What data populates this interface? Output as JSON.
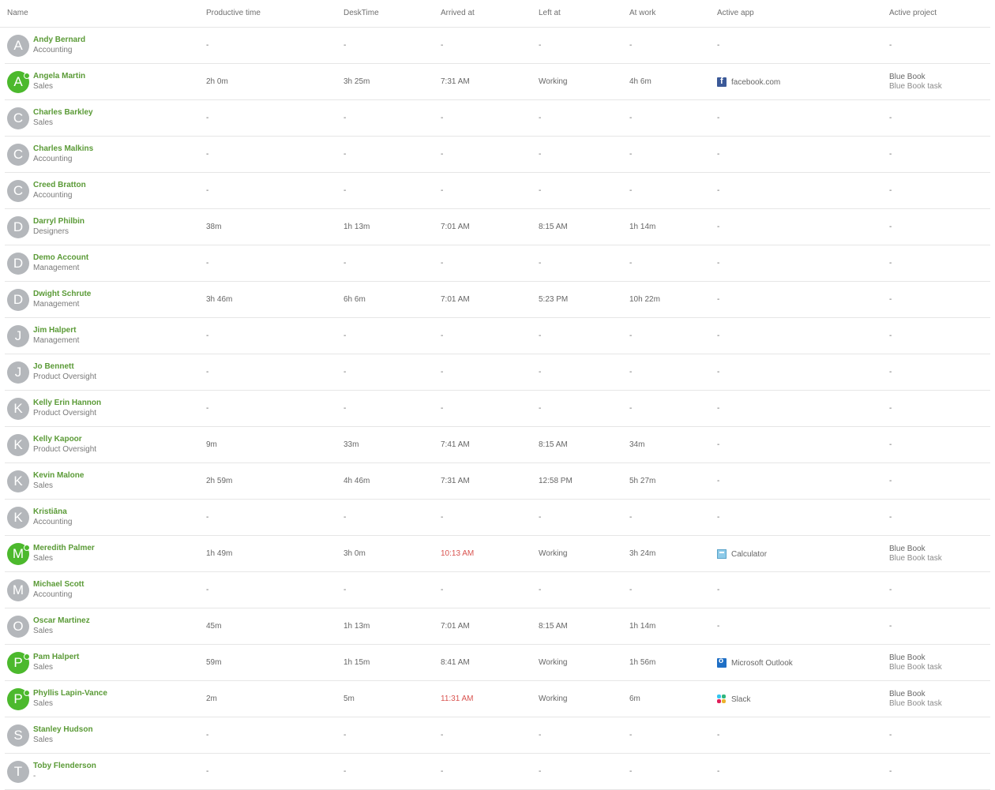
{
  "columns": {
    "name": "Name",
    "productive": "Productive time",
    "desktime": "DeskTime",
    "arrived": "Arrived at",
    "left": "Left at",
    "atwork": "At work",
    "app": "Active app",
    "project": "Active project"
  },
  "colors": {
    "name_link": "#5a9a36",
    "online": "#4cb92d",
    "offline_avatar": "#b4b7bb",
    "late": "#d9534f"
  },
  "rows": [
    {
      "initial": "A",
      "name": "Andy Bernard",
      "team": "Accounting",
      "online": false,
      "productive": "-",
      "desktime": "-",
      "arrived": "-",
      "arrived_late": false,
      "left": "-",
      "atwork": "-",
      "app": "-",
      "app_icon": "",
      "project": "-",
      "task": ""
    },
    {
      "initial": "A",
      "name": "Angela Martin",
      "team": "Sales",
      "online": true,
      "productive": "2h 0m",
      "desktime": "3h 25m",
      "arrived": "7:31 AM",
      "arrived_late": false,
      "left": "Working",
      "atwork": "4h 6m",
      "app": "facebook.com",
      "app_icon": "facebook-icon",
      "project": "Blue Book",
      "task": "Blue Book task"
    },
    {
      "initial": "C",
      "name": "Charles Barkley",
      "team": "Sales",
      "online": false,
      "productive": "-",
      "desktime": "-",
      "arrived": "-",
      "arrived_late": false,
      "left": "-",
      "atwork": "-",
      "app": "-",
      "app_icon": "",
      "project": "-",
      "task": ""
    },
    {
      "initial": "C",
      "name": "Charles Malkins",
      "team": "Accounting",
      "online": false,
      "productive": "-",
      "desktime": "-",
      "arrived": "-",
      "arrived_late": false,
      "left": "-",
      "atwork": "-",
      "app": "-",
      "app_icon": "",
      "project": "-",
      "task": ""
    },
    {
      "initial": "C",
      "name": "Creed Bratton",
      "team": "Accounting",
      "online": false,
      "productive": "-",
      "desktime": "-",
      "arrived": "-",
      "arrived_late": false,
      "left": "-",
      "atwork": "-",
      "app": "-",
      "app_icon": "",
      "project": "-",
      "task": ""
    },
    {
      "initial": "D",
      "name": "Darryl Philbin",
      "team": "Designers",
      "online": false,
      "productive": "38m",
      "desktime": "1h 13m",
      "arrived": "7:01 AM",
      "arrived_late": false,
      "left": "8:15 AM",
      "atwork": "1h 14m",
      "app": "-",
      "app_icon": "",
      "project": "-",
      "task": ""
    },
    {
      "initial": "D",
      "name": "Demo Account",
      "team": "Management",
      "online": false,
      "productive": "-",
      "desktime": "-",
      "arrived": "-",
      "arrived_late": false,
      "left": "-",
      "atwork": "-",
      "app": "-",
      "app_icon": "",
      "project": "-",
      "task": ""
    },
    {
      "initial": "D",
      "name": "Dwight Schrute",
      "team": "Management",
      "online": false,
      "productive": "3h 46m",
      "desktime": "6h 6m",
      "arrived": "7:01 AM",
      "arrived_late": false,
      "left": "5:23 PM",
      "atwork": "10h 22m",
      "app": "-",
      "app_icon": "",
      "project": "-",
      "task": ""
    },
    {
      "initial": "J",
      "name": "Jim Halpert",
      "team": "Management",
      "online": false,
      "productive": "-",
      "desktime": "-",
      "arrived": "-",
      "arrived_late": false,
      "left": "-",
      "atwork": "-",
      "app": "-",
      "app_icon": "",
      "project": "-",
      "task": ""
    },
    {
      "initial": "J",
      "name": "Jo Bennett",
      "team": "Product Oversight",
      "online": false,
      "productive": "-",
      "desktime": "-",
      "arrived": "-",
      "arrived_late": false,
      "left": "-",
      "atwork": "-",
      "app": "-",
      "app_icon": "",
      "project": "-",
      "task": ""
    },
    {
      "initial": "K",
      "name": "Kelly Erin Hannon",
      "team": "Product Oversight",
      "online": false,
      "productive": "-",
      "desktime": "-",
      "arrived": "-",
      "arrived_late": false,
      "left": "-",
      "atwork": "-",
      "app": "-",
      "app_icon": "",
      "project": "-",
      "task": ""
    },
    {
      "initial": "K",
      "name": "Kelly Kapoor",
      "team": "Product Oversight",
      "online": false,
      "productive": "9m",
      "desktime": "33m",
      "arrived": "7:41 AM",
      "arrived_late": false,
      "left": "8:15 AM",
      "atwork": "34m",
      "app": "-",
      "app_icon": "",
      "project": "-",
      "task": ""
    },
    {
      "initial": "K",
      "name": "Kevin Malone",
      "team": "Sales",
      "online": false,
      "productive": "2h 59m",
      "desktime": "4h 46m",
      "arrived": "7:31 AM",
      "arrived_late": false,
      "left": "12:58 PM",
      "atwork": "5h 27m",
      "app": "-",
      "app_icon": "",
      "project": "-",
      "task": ""
    },
    {
      "initial": "K",
      "name": "Kristiāna",
      "team": "Accounting",
      "online": false,
      "productive": "-",
      "desktime": "-",
      "arrived": "-",
      "arrived_late": false,
      "left": "-",
      "atwork": "-",
      "app": "-",
      "app_icon": "",
      "project": "-",
      "task": ""
    },
    {
      "initial": "M",
      "name": "Meredith Palmer",
      "team": "Sales",
      "online": true,
      "productive": "1h 49m",
      "desktime": "3h 0m",
      "arrived": "10:13 AM",
      "arrived_late": true,
      "left": "Working",
      "atwork": "3h 24m",
      "app": "Calculator",
      "app_icon": "calculator-icon",
      "project": "Blue Book",
      "task": "Blue Book task"
    },
    {
      "initial": "M",
      "name": "Michael Scott",
      "team": "Accounting",
      "online": false,
      "productive": "-",
      "desktime": "-",
      "arrived": "-",
      "arrived_late": false,
      "left": "-",
      "atwork": "-",
      "app": "-",
      "app_icon": "",
      "project": "-",
      "task": ""
    },
    {
      "initial": "O",
      "name": "Oscar Martinez",
      "team": "Sales",
      "online": false,
      "productive": "45m",
      "desktime": "1h 13m",
      "arrived": "7:01 AM",
      "arrived_late": false,
      "left": "8:15 AM",
      "atwork": "1h 14m",
      "app": "-",
      "app_icon": "",
      "project": "-",
      "task": ""
    },
    {
      "initial": "P",
      "name": "Pam Halpert",
      "team": "Sales",
      "online": true,
      "productive": "59m",
      "desktime": "1h 15m",
      "arrived": "8:41 AM",
      "arrived_late": false,
      "left": "Working",
      "atwork": "1h 56m",
      "app": "Microsoft Outlook",
      "app_icon": "outlook-icon",
      "project": "Blue Book",
      "task": "Blue Book task"
    },
    {
      "initial": "P",
      "name": "Phyllis Lapin-Vance",
      "team": "Sales",
      "online": true,
      "productive": "2m",
      "desktime": "5m",
      "arrived": "11:31 AM",
      "arrived_late": true,
      "left": "Working",
      "atwork": "6m",
      "app": "Slack",
      "app_icon": "slack-icon",
      "project": "Blue Book",
      "task": "Blue Book task"
    },
    {
      "initial": "S",
      "name": "Stanley Hudson",
      "team": "Sales",
      "online": false,
      "productive": "-",
      "desktime": "-",
      "arrived": "-",
      "arrived_late": false,
      "left": "-",
      "atwork": "-",
      "app": "-",
      "app_icon": "",
      "project": "-",
      "task": ""
    },
    {
      "initial": "T",
      "name": "Toby Flenderson",
      "team": "-",
      "online": false,
      "productive": "-",
      "desktime": "-",
      "arrived": "-",
      "arrived_late": false,
      "left": "-",
      "atwork": "-",
      "app": "-",
      "app_icon": "",
      "project": "-",
      "task": ""
    }
  ]
}
